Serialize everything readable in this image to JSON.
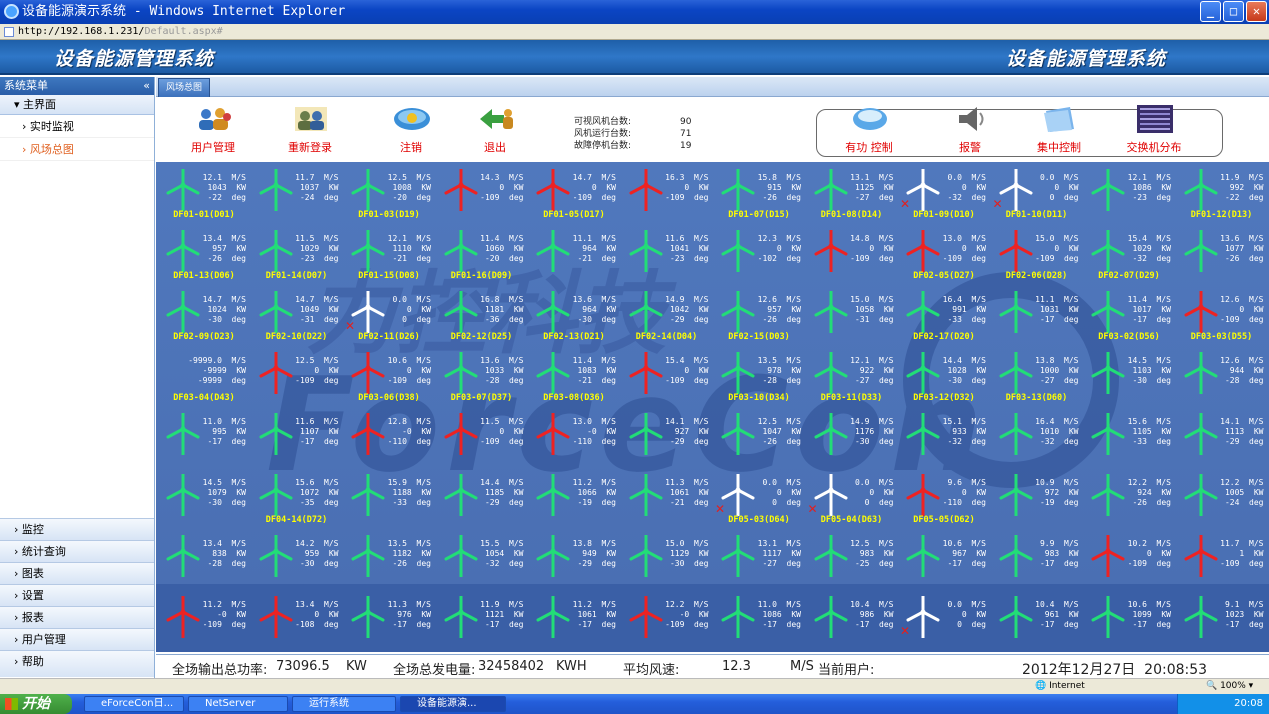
{
  "window": {
    "title": "设备能源演示系统 - Windows Internet Explorer",
    "url": "http://192.168.1.231/",
    "url_tail": "Default.aspx#"
  },
  "banner": {
    "left_title": "设备能源管理系统",
    "right_title": "设备能源管理系统"
  },
  "sidebar": {
    "header": "系统菜单",
    "collapse": "«",
    "main": "主界面",
    "subs": [
      "实时监视",
      "风场总图"
    ],
    "bottom": [
      "监控",
      "统计查询",
      "图表",
      "设置",
      "报表",
      "用户管理",
      "帮助"
    ]
  },
  "tab": {
    "label": "风场总图"
  },
  "toolbar": {
    "buttons": [
      "用户管理",
      "重新登录",
      "注销",
      "退出"
    ],
    "right_buttons": [
      "有功 控制",
      "报警",
      "集中控制",
      "交换机分布"
    ],
    "stats": [
      {
        "label": "可视风机台数:",
        "value": "90"
      },
      {
        "label": "风机运行台数:",
        "value": "71"
      },
      {
        "label": "故障停机台数:",
        "value": "19"
      }
    ]
  },
  "colors": {
    "running": "#22dd77",
    "stopped": "#ee2222",
    "offline": "#ffffff",
    "name_ok": "#ffff00",
    "name_alt": "#ff40ff"
  },
  "turbines": [
    [
      {
        "s": "12.1",
        "p": "1043",
        "d": "-22",
        "st": "g",
        "n": "DF01-01(D01)",
        "c": "y"
      },
      {
        "s": "11.7",
        "p": "1037",
        "d": "-24",
        "st": "g",
        "n": "",
        "c": "y"
      },
      {
        "s": "12.5",
        "p": "1008",
        "d": "-20",
        "st": "g",
        "n": "DF01-03(D19)",
        "c": "y"
      },
      {
        "s": "14.3",
        "p": "0",
        "d": "-109",
        "st": "r",
        "n": "",
        "c": "y"
      },
      {
        "s": "14.7",
        "p": "0",
        "d": "-109",
        "st": "r",
        "n": "DF01-05(D17)",
        "c": "y"
      },
      {
        "s": "16.3",
        "p": "0",
        "d": "-109",
        "st": "r",
        "n": "",
        "c": "y"
      },
      {
        "s": "15.8",
        "p": "915",
        "d": "-26",
        "st": "g",
        "n": "DF01-07(D15)",
        "c": "y"
      },
      {
        "s": "13.1",
        "p": "1125",
        "d": "-27",
        "st": "g",
        "n": "DF01-08(D14)",
        "c": "y"
      },
      {
        "s": "0.0",
        "p": "0",
        "d": "-32",
        "st": "w",
        "n": "DF01-09(D10)",
        "c": "y"
      },
      {
        "s": "0.0",
        "p": "0",
        "d": "0",
        "st": "w",
        "n": "DF01-10(D11)",
        "c": "y"
      },
      {
        "s": "12.1",
        "p": "1086",
        "d": "-23",
        "st": "g",
        "n": "",
        "c": "y"
      },
      {
        "s": "11.9",
        "p": "992",
        "d": "-22",
        "st": "g",
        "n": "DF01-12(D13)",
        "c": "y"
      }
    ],
    [
      {
        "s": "13.4",
        "p": "957",
        "d": "-26",
        "st": "g",
        "n": "DF01-13(D06)",
        "c": "y"
      },
      {
        "s": "11.5",
        "p": "1029",
        "d": "-23",
        "st": "g",
        "n": "DF01-14(D07)",
        "c": "y"
      },
      {
        "s": "12.1",
        "p": "1110",
        "d": "-21",
        "st": "g",
        "n": "DF01-15(D08)",
        "c": "y"
      },
      {
        "s": "11.4",
        "p": "1060",
        "d": "-20",
        "st": "g",
        "n": "DF01-16(D09)",
        "c": "y"
      },
      {
        "s": "11.1",
        "p": "964",
        "d": "-21",
        "st": "g",
        "n": "",
        "c": "m"
      },
      {
        "s": "11.6",
        "p": "1041",
        "d": "-23",
        "st": "g",
        "n": "",
        "c": "m"
      },
      {
        "s": "12.3",
        "p": "0",
        "d": "-102",
        "st": "g",
        "n": "",
        "c": "m"
      },
      {
        "s": "14.8",
        "p": "0",
        "d": "-109",
        "st": "r",
        "n": "",
        "c": "m"
      },
      {
        "s": "13.0",
        "p": "0",
        "d": "-109",
        "st": "r",
        "n": "DF02-05(D27)",
        "c": "y"
      },
      {
        "s": "15.0",
        "p": "0",
        "d": "-109",
        "st": "r",
        "n": "DF02-06(D28)",
        "c": "y"
      },
      {
        "s": "15.4",
        "p": "1029",
        "d": "-32",
        "st": "g",
        "n": "DF02-07(D29)",
        "c": "y"
      },
      {
        "s": "13.6",
        "p": "1077",
        "d": "-26",
        "st": "g",
        "n": "",
        "c": "m"
      }
    ],
    [
      {
        "s": "14.7",
        "p": "1024",
        "d": "-30",
        "st": "g",
        "n": "DF02-09(D23)",
        "c": "y"
      },
      {
        "s": "14.7",
        "p": "1049",
        "d": "-31",
        "st": "g",
        "n": "DF02-10(D22)",
        "c": "y"
      },
      {
        "s": "0.0",
        "p": "0",
        "d": "0",
        "st": "w",
        "n": "DF02-11(D26)",
        "c": "y"
      },
      {
        "s": "16.8",
        "p": "1181",
        "d": "-36",
        "st": "g",
        "n": "DF02-12(D25)",
        "c": "y"
      },
      {
        "s": "13.6",
        "p": "964",
        "d": "-30",
        "st": "g",
        "n": "DF02-13(D21)",
        "c": "y"
      },
      {
        "s": "14.9",
        "p": "1042",
        "d": "-29",
        "st": "g",
        "n": "DF02-14(D04)",
        "c": "y"
      },
      {
        "s": "12.6",
        "p": "957",
        "d": "-26",
        "st": "g",
        "n": "DF02-15(D03)",
        "c": "y"
      },
      {
        "s": "15.0",
        "p": "1058",
        "d": "-31",
        "st": "g",
        "n": "",
        "c": "y"
      },
      {
        "s": "16.4",
        "p": "991",
        "d": "-33",
        "st": "g",
        "n": "DF02-17(D20)",
        "c": "y"
      },
      {
        "s": "11.1",
        "p": "1031",
        "d": "-17",
        "st": "g",
        "n": "",
        "c": "m"
      },
      {
        "s": "11.4",
        "p": "1017",
        "d": "-17",
        "st": "g",
        "n": "DF03-02(D56)",
        "c": "y"
      },
      {
        "s": "12.6",
        "p": "0",
        "d": "-109",
        "st": "r",
        "n": "DF03-03(D55)",
        "c": "y"
      }
    ],
    [
      {
        "s": "-9999.0",
        "p": "-9999",
        "d": "-9999",
        "st": "n",
        "n": "DF03-04(D43)",
        "c": "y"
      },
      {
        "s": "12.5",
        "p": "0",
        "d": "-109",
        "st": "r",
        "n": "",
        "c": "m"
      },
      {
        "s": "10.6",
        "p": "0",
        "d": "-109",
        "st": "r",
        "n": "DF03-06(D38)",
        "c": "y"
      },
      {
        "s": "13.6",
        "p": "1033",
        "d": "-28",
        "st": "g",
        "n": "DF03-07(D37)",
        "c": "y"
      },
      {
        "s": "11.4",
        "p": "1083",
        "d": "-21",
        "st": "g",
        "n": "DF03-08(D36)",
        "c": "y"
      },
      {
        "s": "15.4",
        "p": "0",
        "d": "-109",
        "st": "r",
        "n": "",
        "c": "y"
      },
      {
        "s": "13.5",
        "p": "978",
        "d": "-28",
        "st": "g",
        "n": "DF03-10(D34)",
        "c": "y"
      },
      {
        "s": "12.1",
        "p": "922",
        "d": "-27",
        "st": "g",
        "n": "DF03-11(D33)",
        "c": "y"
      },
      {
        "s": "14.4",
        "p": "1028",
        "d": "-30",
        "st": "g",
        "n": "DF03-12(D32)",
        "c": "y"
      },
      {
        "s": "13.8",
        "p": "1000",
        "d": "-27",
        "st": "g",
        "n": "DF03-13(D60)",
        "c": "y"
      },
      {
        "s": "14.5",
        "p": "1103",
        "d": "-30",
        "st": "g",
        "n": "",
        "c": "m"
      },
      {
        "s": "12.6",
        "p": "944",
        "d": "-28",
        "st": "g",
        "n": "",
        "c": "m"
      }
    ],
    [
      {
        "s": "11.0",
        "p": "995",
        "d": "-17",
        "st": "g",
        "n": "",
        "c": "m"
      },
      {
        "s": "11.6",
        "p": "1107",
        "d": "-17",
        "st": "g",
        "n": "",
        "c": "m"
      },
      {
        "s": "12.8",
        "p": "-0",
        "d": "-110",
        "st": "r",
        "n": "",
        "c": "m"
      },
      {
        "s": "11.5",
        "p": "0",
        "d": "-109",
        "st": "r",
        "n": "",
        "c": "y"
      },
      {
        "s": "13.0",
        "p": "-0",
        "d": "-110",
        "st": "r",
        "n": "",
        "c": "m"
      },
      {
        "s": "14.1",
        "p": "927",
        "d": "-29",
        "st": "g",
        "n": "",
        "c": "m"
      },
      {
        "s": "12.5",
        "p": "1047",
        "d": "-26",
        "st": "g",
        "n": "",
        "c": "m"
      },
      {
        "s": "14.9",
        "p": "1176",
        "d": "-30",
        "st": "g",
        "n": "",
        "c": "m"
      },
      {
        "s": "15.1",
        "p": "933",
        "d": "-32",
        "st": "g",
        "n": "",
        "c": "m"
      },
      {
        "s": "16.4",
        "p": "1010",
        "d": "-32",
        "st": "g",
        "n": "",
        "c": "m"
      },
      {
        "s": "15.6",
        "p": "1105",
        "d": "-33",
        "st": "g",
        "n": "",
        "c": "m"
      },
      {
        "s": "14.1",
        "p": "1113",
        "d": "-29",
        "st": "g",
        "n": "",
        "c": "m"
      }
    ],
    [
      {
        "s": "14.5",
        "p": "1079",
        "d": "-30",
        "st": "g",
        "n": "",
        "c": "m"
      },
      {
        "s": "15.6",
        "p": "1072",
        "d": "-35",
        "st": "g",
        "n": "DF04-14(D72)",
        "c": "y"
      },
      {
        "s": "15.9",
        "p": "1188",
        "d": "-33",
        "st": "g",
        "n": "",
        "c": "m"
      },
      {
        "s": "14.4",
        "p": "1185",
        "d": "-29",
        "st": "g",
        "n": "",
        "c": "m"
      },
      {
        "s": "11.2",
        "p": "1066",
        "d": "-19",
        "st": "g",
        "n": "",
        "c": "m"
      },
      {
        "s": "11.3",
        "p": "1061",
        "d": "-21",
        "st": "g",
        "n": "",
        "c": "m"
      },
      {
        "s": "0.0",
        "p": "0",
        "d": "0",
        "st": "w",
        "n": "DF05-03(D64)",
        "c": "y"
      },
      {
        "s": "0.0",
        "p": "0",
        "d": "0",
        "st": "w",
        "n": "DF05-04(D63)",
        "c": "y"
      },
      {
        "s": "9.6",
        "p": "0",
        "d": "-110",
        "st": "r",
        "n": "DF05-05(D62)",
        "c": "y"
      },
      {
        "s": "10.9",
        "p": "972",
        "d": "-19",
        "st": "g",
        "n": "",
        "c": "m"
      },
      {
        "s": "12.2",
        "p": "924",
        "d": "-26",
        "st": "g",
        "n": "",
        "c": "m"
      },
      {
        "s": "12.2",
        "p": "1005",
        "d": "-24",
        "st": "g",
        "n": "",
        "c": "m"
      }
    ],
    [
      {
        "s": "13.4",
        "p": "838",
        "d": "-28",
        "st": "g",
        "n": "",
        "c": "m"
      },
      {
        "s": "14.2",
        "p": "959",
        "d": "-30",
        "st": "g",
        "n": "",
        "c": "m"
      },
      {
        "s": "13.5",
        "p": "1182",
        "d": "-26",
        "st": "g",
        "n": "",
        "c": "m"
      },
      {
        "s": "15.5",
        "p": "1054",
        "d": "-32",
        "st": "g",
        "n": "",
        "c": "m"
      },
      {
        "s": "13.8",
        "p": "949",
        "d": "-29",
        "st": "g",
        "n": "",
        "c": "m"
      },
      {
        "s": "15.0",
        "p": "1129",
        "d": "-30",
        "st": "g",
        "n": "",
        "c": "m"
      },
      {
        "s": "13.1",
        "p": "1117",
        "d": "-27",
        "st": "g",
        "n": "",
        "c": "m"
      },
      {
        "s": "12.5",
        "p": "983",
        "d": "-25",
        "st": "g",
        "n": "",
        "c": "m"
      },
      {
        "s": "10.6",
        "p": "967",
        "d": "-17",
        "st": "g",
        "n": "",
        "c": "m"
      },
      {
        "s": "9.9",
        "p": "983",
        "d": "-17",
        "st": "g",
        "n": "",
        "c": "m"
      },
      {
        "s": "10.2",
        "p": "0",
        "d": "-109",
        "st": "r",
        "n": "",
        "c": "m"
      },
      {
        "s": "11.7",
        "p": "1",
        "d": "-109",
        "st": "r",
        "n": "",
        "c": "m"
      }
    ],
    [
      {
        "s": "11.2",
        "p": "-0",
        "d": "-109",
        "st": "r",
        "n": "",
        "c": "m"
      },
      {
        "s": "13.4",
        "p": "0",
        "d": "-108",
        "st": "r",
        "n": "",
        "c": "y"
      },
      {
        "s": "11.3",
        "p": "976",
        "d": "-17",
        "st": "g",
        "n": "",
        "c": "m"
      },
      {
        "s": "11.9",
        "p": "1121",
        "d": "-17",
        "st": "g",
        "n": "",
        "c": "m"
      },
      {
        "s": "11.2",
        "p": "1061",
        "d": "-17",
        "st": "g",
        "n": "",
        "c": "m"
      },
      {
        "s": "12.2",
        "p": "-0",
        "d": "-109",
        "st": "r",
        "n": "",
        "c": "y"
      },
      {
        "s": "11.0",
        "p": "1086",
        "d": "-17",
        "st": "g",
        "n": "",
        "c": "m"
      },
      {
        "s": "10.4",
        "p": "986",
        "d": "-17",
        "st": "g",
        "n": "",
        "c": "m"
      },
      {
        "s": "0.0",
        "p": "0",
        "d": "0",
        "st": "w",
        "n": "",
        "c": "m"
      },
      {
        "s": "10.4",
        "p": "961",
        "d": "-17",
        "st": "g",
        "n": "",
        "c": "m"
      },
      {
        "s": "10.6",
        "p": "1099",
        "d": "-17",
        "st": "g",
        "n": "",
        "c": "m"
      },
      {
        "s": "9.1",
        "p": "1023",
        "d": "-17",
        "st": "g",
        "n": "",
        "c": "m"
      }
    ]
  ],
  "units": {
    "speed": "M/S",
    "power": "KW",
    "dir": "deg"
  },
  "status": {
    "total_power_label": "全场输出总功率:",
    "total_power": "73096.5",
    "power_unit": "KW",
    "total_energy_label": "全场总发电量:",
    "total_energy": "32458402",
    "energy_unit": "KWH",
    "avg_wind_label": "平均风速:",
    "avg_wind": "12.3",
    "wind_unit": "M/S",
    "user_label": "当前用户:",
    "datetime": "2012年12月27日  20:08:53"
  },
  "ie_status": {
    "zone": "Internet",
    "zoom": "100%"
  },
  "taskbar": {
    "start": "开始",
    "tasks": [
      "eForceCon日...",
      "NetServer",
      "运行系统",
      "设备能源演..."
    ],
    "clock": "20:08"
  }
}
